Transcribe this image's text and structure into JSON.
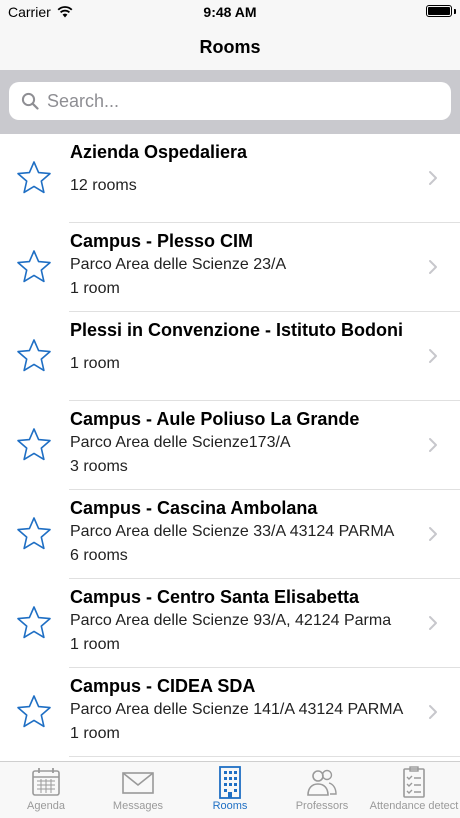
{
  "status_bar": {
    "carrier": "Carrier",
    "time": "9:48 AM"
  },
  "nav": {
    "title": "Rooms"
  },
  "search": {
    "placeholder": "Search..."
  },
  "colors": {
    "accent": "#1f6fc4",
    "inactive": "#9a9a9a"
  },
  "rooms": [
    {
      "name": "Azienda Ospedaliera",
      "address": "",
      "count": "12 rooms"
    },
    {
      "name": "Campus - Plesso CIM",
      "address": "Parco Area delle Scienze 23/A",
      "count": "1 room"
    },
    {
      "name": "Plessi in Convenzione - Istituto Bodoni",
      "address": "",
      "count": "1 room"
    },
    {
      "name": "Campus - Aule Poliuso La Grande",
      "address": "Parco Area delle Scienze173/A",
      "count": "3 rooms"
    },
    {
      "name": "Campus - Cascina Ambolana",
      "address": "Parco Area delle Scienze 33/A 43124 PARMA",
      "count": "6 rooms"
    },
    {
      "name": "Campus - Centro Santa Elisabetta",
      "address": "Parco Area delle Scienze 93/A, 42124 Parma",
      "count": "1 room"
    },
    {
      "name": "Campus - CIDEA SDA",
      "address": "Parco Area delle Scienze 141/A 43124 PARMA",
      "count": "1 room"
    }
  ],
  "tabs": [
    {
      "label": "Agenda",
      "icon": "calendar-icon",
      "active": false
    },
    {
      "label": "Messages",
      "icon": "envelope-icon",
      "active": false
    },
    {
      "label": "Rooms",
      "icon": "building-icon",
      "active": true
    },
    {
      "label": "Professors",
      "icon": "people-icon",
      "active": false
    },
    {
      "label": "Attendance detect",
      "icon": "checklist-icon",
      "active": false
    }
  ]
}
